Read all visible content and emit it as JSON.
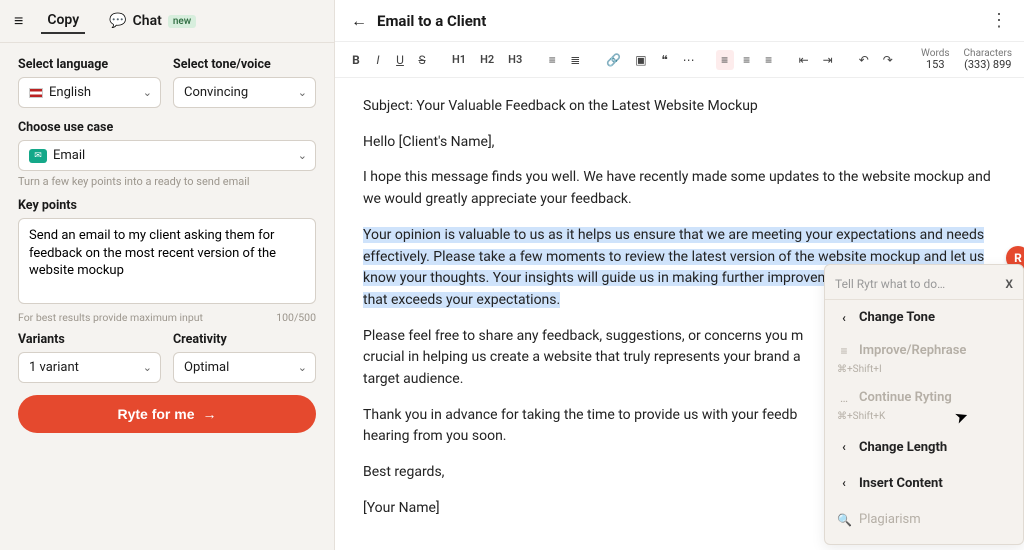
{
  "sidebar": {
    "tab_copy": "Copy",
    "tab_chat": "Chat",
    "chat_badge": "new",
    "language_label": "Select language",
    "language_value": "English",
    "tone_label": "Select tone/voice",
    "tone_value": "Convincing",
    "usecase_label": "Choose use case",
    "usecase_value": "Email",
    "usecase_help": "Turn a few key points into a ready to send email",
    "keypoints_label": "Key points",
    "keypoints_value": "Send an email to my client asking them for feedback on the most recent version of the website mockup",
    "keypoints_help": "For best results provide maximum input",
    "keypoints_count": "100/500",
    "variants_label": "Variants",
    "variants_value": "1 variant",
    "creativity_label": "Creativity",
    "creativity_value": "Optimal",
    "ryte_button": "Ryte for me"
  },
  "doc": {
    "title": "Email to a Client",
    "subject": "Subject: Your Valuable Feedback on the Latest Website Mockup",
    "greeting": "Hello [Client's Name],",
    "p1": "I hope this message finds you well. We have recently made some updates to the website mockup and we would greatly appreciate your feedback.",
    "p2": "Your opinion is valuable to us as it helps us ensure that we are meeting your expectations and needs effectively. Please take a few moments to review the latest version of the website mockup and let us know your thoughts. Your insights will guide us in making further improvements to deliver a website that exceeds your expectations.",
    "p3a": "Please feel free to share any feedback, suggestions, or concerns you m",
    "p3b": "crucial in helping us create a website that truly represents your brand a",
    "p3c": "target audience.",
    "p4a": "Thank you in advance for taking the time to provide us with your feedb",
    "p4b": "hearing from you soon.",
    "closing": "Best regards,",
    "signature": "[Your Name]"
  },
  "stats": {
    "words_label": "Words",
    "words_value": "153",
    "chars_label": "Characters",
    "chars_value": "(333) 899"
  },
  "toolbar": {
    "B": "B",
    "I": "I",
    "U": "U",
    "S": "S",
    "H1": "H1",
    "H2": "H2",
    "H3": "H3"
  },
  "popup": {
    "placeholder": "Tell Rytr what to do…",
    "change_tone": "Change Tone",
    "improve": "Improve/Rephrase",
    "improve_kb": "⌘+Shift+I",
    "continue": "Continue Ryting",
    "continue_kb": "⌘+Shift+K",
    "change_length": "Change Length",
    "insert_content": "Insert Content",
    "plagiarism": "Plagiarism"
  }
}
